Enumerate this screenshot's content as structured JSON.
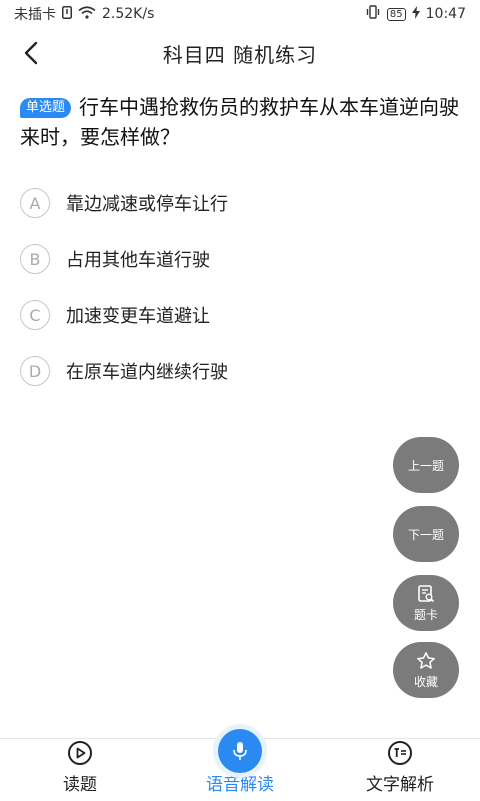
{
  "status_bar": {
    "carrier": "未插卡",
    "speed": "2.52K/s",
    "battery": "85",
    "time": "10:47"
  },
  "header": {
    "title": "科目四 随机练习"
  },
  "question": {
    "type": "单选题",
    "text": "行车中遇抢救伤员的救护车从本车道逆向驶来时，要怎样做？"
  },
  "options": [
    {
      "letter": "A",
      "text": "靠边减速或停车让行"
    },
    {
      "letter": "B",
      "text": "占用其他车道行驶"
    },
    {
      "letter": "C",
      "text": "加速变更车道避让"
    },
    {
      "letter": "D",
      "text": "在原车道内继续行驶"
    }
  ],
  "fabs": {
    "prev": "上一题",
    "next": "下一题",
    "card": "题卡",
    "favorite": "收藏"
  },
  "bottom_nav": {
    "read": "读题",
    "voice": "语音解读",
    "text_analysis": "文字解析"
  },
  "colors": {
    "accent": "#2b8af2",
    "fab_bg": "#7b7b7b"
  }
}
